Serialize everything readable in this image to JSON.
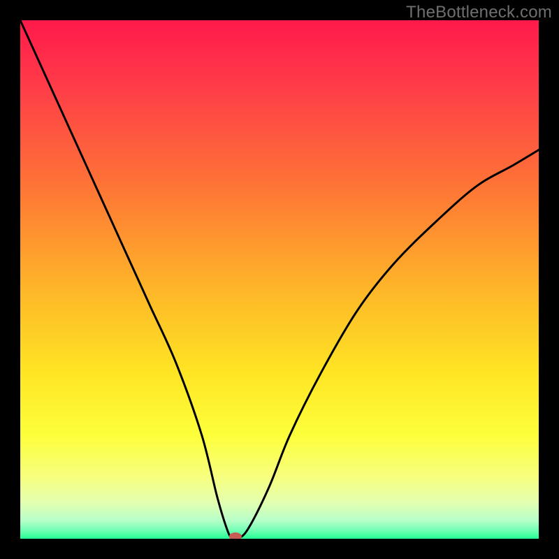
{
  "watermark": "TheBottleneck.com",
  "chart_data": {
    "type": "line",
    "title": "",
    "xlabel": "",
    "ylabel": "",
    "xlim": [
      0,
      100
    ],
    "ylim": [
      0,
      100
    ],
    "x": [
      0,
      5,
      10,
      15,
      20,
      25,
      30,
      35,
      38,
      40,
      41,
      42,
      44,
      48,
      52,
      58,
      65,
      72,
      80,
      88,
      95,
      100
    ],
    "values": [
      100,
      89,
      78,
      67,
      56,
      45,
      34,
      20,
      8,
      1.5,
      0,
      0,
      2,
      10,
      20,
      32,
      44,
      53,
      61,
      68,
      72,
      75
    ],
    "curve_minimum_x": 41.5,
    "marker": {
      "x": 41.5,
      "y": 0
    },
    "gradient_stops": [
      {
        "pos": 0.0,
        "color": "#ff1a4b"
      },
      {
        "pos": 0.12,
        "color": "#ff3a49"
      },
      {
        "pos": 0.32,
        "color": "#fe7436"
      },
      {
        "pos": 0.52,
        "color": "#feb628"
      },
      {
        "pos": 0.68,
        "color": "#ffe524"
      },
      {
        "pos": 0.8,
        "color": "#fdff3b"
      },
      {
        "pos": 0.88,
        "color": "#f7ff7e"
      },
      {
        "pos": 0.93,
        "color": "#e3ffb0"
      },
      {
        "pos": 0.965,
        "color": "#b6ffc9"
      },
      {
        "pos": 0.985,
        "color": "#6dffb2"
      },
      {
        "pos": 1.0,
        "color": "#22ff94"
      }
    ],
    "marker_color": "#c75c56",
    "curve_color": "#000000",
    "curve_stroke_width": 3
  }
}
